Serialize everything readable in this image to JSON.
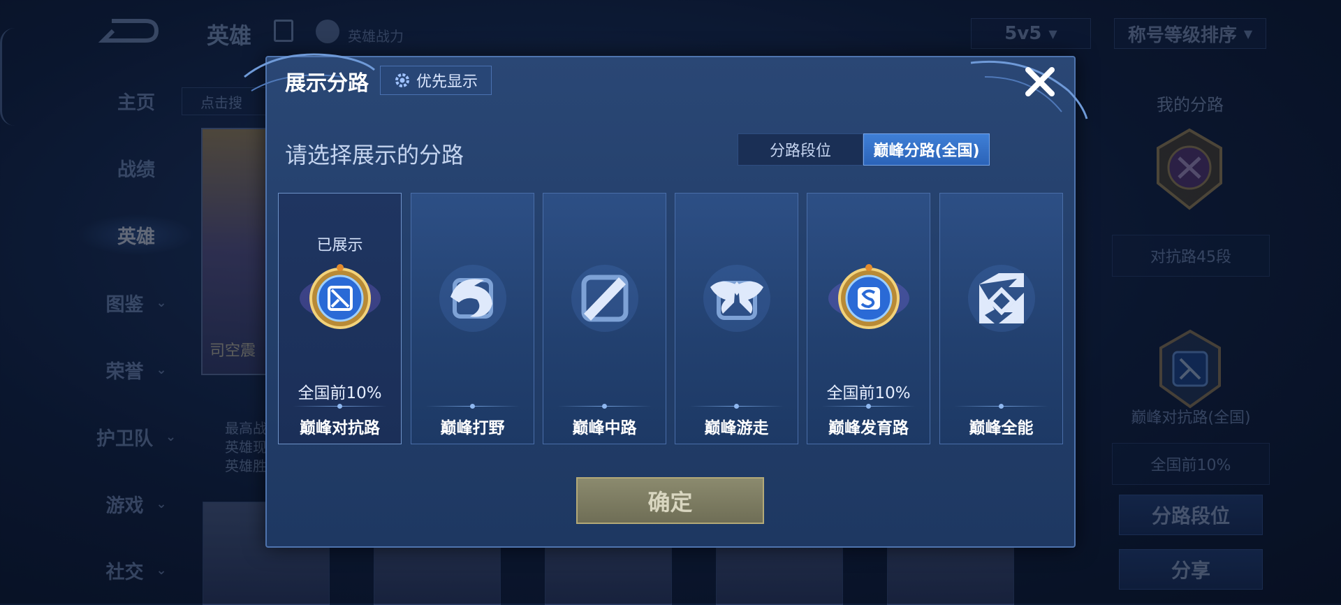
{
  "header": {
    "title": "英雄",
    "power_label": "英雄战力",
    "mode_select": "5v5",
    "sort_select": "称号等级排序"
  },
  "sidebar": {
    "items": [
      {
        "label": "主页",
        "active": false
      },
      {
        "label": "战绩",
        "active": false
      },
      {
        "label": "英雄",
        "active": true
      },
      {
        "label": "图鉴",
        "active": false
      },
      {
        "label": "荣誉",
        "active": false
      },
      {
        "label": "护卫队",
        "active": false
      },
      {
        "label": "游戏",
        "active": false
      },
      {
        "label": "社交",
        "active": false
      }
    ]
  },
  "hero_panel": {
    "search_placeholder": "点击搜",
    "hero_name": "司空震",
    "desc_lines": [
      "最高战",
      "英雄现",
      "英雄胜"
    ]
  },
  "right_panel": {
    "title": "我的分路",
    "rank_text": "对抗路45段",
    "peak_lane": "巅峰对抗路(全国)",
    "peak_rank": "全国前10%",
    "lane_rank_button": "分路段位",
    "share_button": "分享"
  },
  "modal": {
    "title": "展示分路",
    "priority_button": "优先显示",
    "subtitle": "请选择展示的分路",
    "tabs": [
      {
        "label": "分路段位",
        "active": false
      },
      {
        "label": "巅峰分路(全国)",
        "active": true
      }
    ],
    "lanes": [
      {
        "name": "巅峰对抗路",
        "status": "已展示",
        "rank": "全国前10%",
        "icon": "clash-lane-icon",
        "ranked": true
      },
      {
        "name": "巅峰打野",
        "status": "",
        "rank": "",
        "icon": "jungle-dragon-icon",
        "ranked": false
      },
      {
        "name": "巅峰中路",
        "status": "",
        "rank": "",
        "icon": "mid-lane-icon",
        "ranked": false
      },
      {
        "name": "巅峰游走",
        "status": "",
        "rank": "",
        "icon": "roam-wings-icon",
        "ranked": false
      },
      {
        "name": "巅峰发育路",
        "status": "",
        "rank": "全国前10%",
        "icon": "farm-lane-icon",
        "ranked": true
      },
      {
        "name": "巅峰全能",
        "status": "",
        "rank": "",
        "icon": "all-round-icon",
        "ranked": false
      }
    ],
    "confirm_button": "确定"
  },
  "colors": {
    "accent": "#2b63b8",
    "modal_bg": "#24406c",
    "gold": "#d8a94a",
    "confirm_disabled": "#7a7960"
  }
}
